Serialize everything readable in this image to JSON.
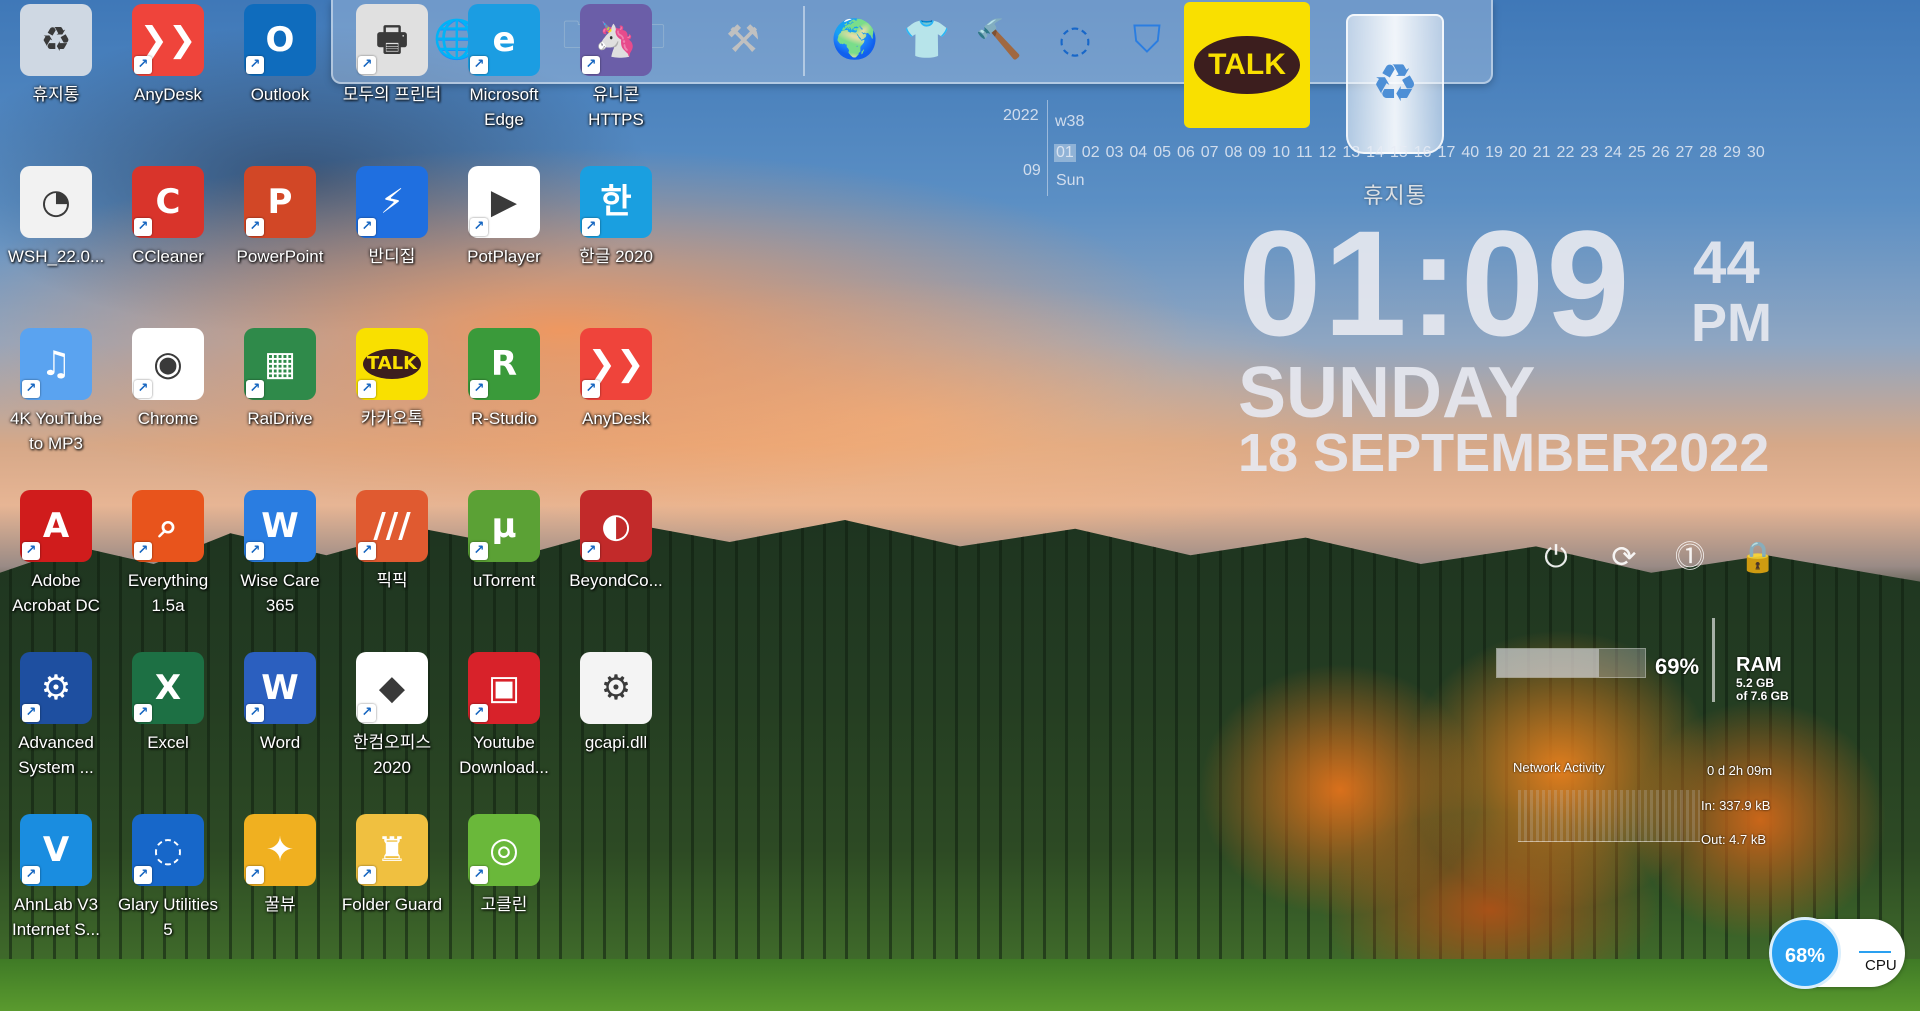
{
  "desktop_icons": [
    {
      "label": "휴지통",
      "icon": "recycle-bin-icon",
      "color": "#cfd8e3"
    },
    {
      "label": "AnyDesk",
      "icon": "anydesk-icon",
      "color": "#ef443b"
    },
    {
      "label": "Outlook",
      "icon": "outlook-icon",
      "color": "#0f6cbd"
    },
    {
      "label": "모두의 프린터",
      "icon": "printer-icon",
      "color": "#e0e0e0"
    },
    {
      "label": "Microsoft Edge",
      "icon": "edge-icon",
      "color": "#1b9de2"
    },
    {
      "label": "유니콘 HTTPS",
      "icon": "unicorn-icon",
      "color": "#6b5ea8"
    },
    {
      "label": "WSH_22.0...",
      "icon": "file-icon",
      "color": "#f2f2f2"
    },
    {
      "label": "CCleaner",
      "icon": "ccleaner-icon",
      "color": "#d9342b"
    },
    {
      "label": "PowerPoint",
      "icon": "powerpoint-icon",
      "color": "#d24726"
    },
    {
      "label": "반디집",
      "icon": "bandizip-icon",
      "color": "#1f6fe0"
    },
    {
      "label": "PotPlayer",
      "icon": "potplayer-icon",
      "color": "#ffffff"
    },
    {
      "label": "한글 2020",
      "icon": "hangul-icon",
      "color": "#1a9fe0"
    },
    {
      "label": "4K YouTube to MP3",
      "icon": "youtube-mp3-icon",
      "color": "#5aa3f0"
    },
    {
      "label": "Chrome",
      "icon": "chrome-icon",
      "color": "#ffffff"
    },
    {
      "label": "RaiDrive",
      "icon": "raidrive-icon",
      "color": "#2f8a4a"
    },
    {
      "label": "카카오톡",
      "icon": "kakaotalk-icon",
      "color": "#f9e000"
    },
    {
      "label": "R-Studio",
      "icon": "r-studio-icon",
      "color": "#3a9a3a"
    },
    {
      "label": "AnyDesk",
      "icon": "anydesk-icon",
      "color": "#ef443b"
    },
    {
      "label": "Adobe Acrobat DC",
      "icon": "acrobat-icon",
      "color": "#d01c1c"
    },
    {
      "label": "Everything 1.5a",
      "icon": "everything-icon",
      "color": "#e8541c"
    },
    {
      "label": "Wise Care 365",
      "icon": "wise-care-icon",
      "color": "#2a7de1"
    },
    {
      "label": "픽픽",
      "icon": "picpick-icon",
      "color": "#e05a30"
    },
    {
      "label": "uTorrent",
      "icon": "utorrent-icon",
      "color": "#5ba135"
    },
    {
      "label": "BeyondCo...",
      "icon": "beyond-compare-icon",
      "color": "#c22a2a"
    },
    {
      "label": "Advanced System ...",
      "icon": "advanced-systemcare-icon",
      "color": "#1e4fa0"
    },
    {
      "label": "Excel",
      "icon": "excel-icon",
      "color": "#1d7044"
    },
    {
      "label": "Word",
      "icon": "word-icon",
      "color": "#2b5fbf"
    },
    {
      "label": "한컴오피스 2020",
      "icon": "hancom-office-icon",
      "color": "#ffffff"
    },
    {
      "label": "Youtube Download...",
      "icon": "youtube-downloader-icon",
      "color": "#d8222a"
    },
    {
      "label": "gcapi.dll",
      "icon": "dll-file-icon",
      "color": "#f4f4f4"
    },
    {
      "label": "AhnLab V3 Internet S...",
      "icon": "ahnlab-icon",
      "color": "#1a8de0"
    },
    {
      "label": "Glary Utilities 5",
      "icon": "glary-icon",
      "color": "#1767c9"
    },
    {
      "label": "꿀뷰",
      "icon": "honeyview-icon",
      "color": "#f0b020"
    },
    {
      "label": "Folder Guard",
      "icon": "folder-guard-icon",
      "color": "#f0c040"
    },
    {
      "label": "고클린",
      "icon": "goclean-icon",
      "color": "#6ab83a"
    }
  ],
  "dock": {
    "items": [
      {
        "name": "dock-printer-icon"
      },
      {
        "name": "dock-globe-icon"
      },
      {
        "name": "dock-folder-icon"
      },
      {
        "name": "dock-folder-icon"
      },
      {
        "name": "dock-folder-icon"
      },
      {
        "name": "dock-tools-icon"
      },
      {
        "name": "dock-network-globe-icon"
      },
      {
        "name": "dock-tshirt-icon"
      },
      {
        "name": "dock-hammer-icon"
      },
      {
        "name": "dock-glary-icon"
      },
      {
        "name": "dock-wise-care-icon"
      }
    ],
    "talk_label": "TALK",
    "recycle_bin_label": "휴지통"
  },
  "calendar": {
    "year": "2022",
    "week": "w38",
    "month": "09",
    "weekday": "Sun",
    "days": [
      "01",
      "02",
      "03",
      "04",
      "05",
      "06",
      "07",
      "08",
      "09",
      "10",
      "11",
      "12",
      "13",
      "14",
      "15",
      "16",
      "17",
      "40",
      "19",
      "20",
      "21",
      "22",
      "23",
      "24",
      "25",
      "26",
      "27",
      "28",
      "29",
      "30"
    ],
    "today": "01"
  },
  "clock": {
    "time": "01:09",
    "seconds": "44",
    "ampm": "PM",
    "day": "SUNDAY",
    "date": "18 SEPTEMBER2022"
  },
  "power": [
    "power-icon",
    "restart-icon",
    "sleep-icon",
    "lock-icon"
  ],
  "ram": {
    "percent": "69%",
    "percent_value": 0.69,
    "title": "RAM",
    "used": "5.2 GB",
    "total": "of 7.6 GB"
  },
  "network": {
    "title": "Network Activity",
    "uptime": "0 d 2h 09m",
    "in": "In: 337.9 kB",
    "out": "Out: 4.7 kB"
  },
  "cpu": {
    "percent": "68%",
    "label": "CPU"
  }
}
